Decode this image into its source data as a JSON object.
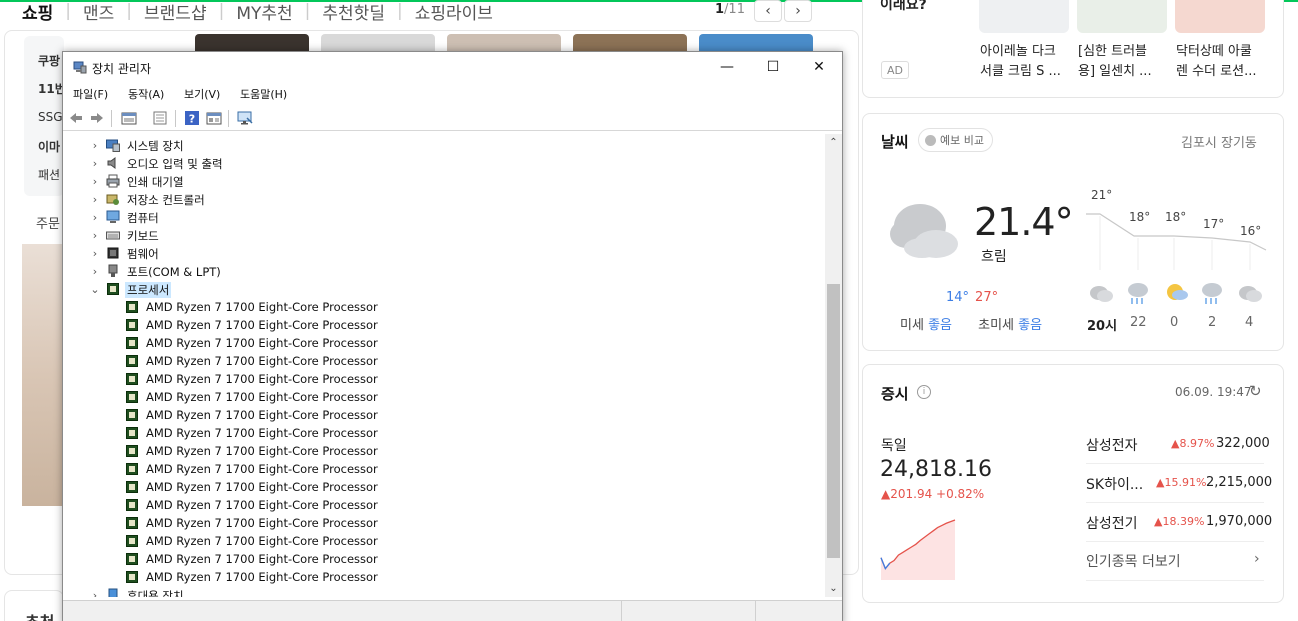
{
  "shopping": {
    "tabs": [
      "쇼핑",
      "맨즈",
      "브랜드샵",
      "MY추천",
      "추천핫딜",
      "쇼핑라이브"
    ],
    "page_current": "1",
    "page_total": "/11",
    "prev_glyph": "‹",
    "next_glyph": "›",
    "left_menu": [
      "쿠팡",
      "11번",
      "SSG",
      "이마",
      "패션"
    ],
    "order_label": "주문",
    "bottom_label": "추천"
  },
  "ad": {
    "title": "이래요?",
    "badge": "AD",
    "items": [
      {
        "line1": "아이레놀 다크",
        "line2": "서클 크림 S ..."
      },
      {
        "line1": "[심한 트러블",
        "line2": "용] 일센치 ..."
      },
      {
        "line1": "닥터상떼 아쿨",
        "line2": "렌 수더 로션..."
      }
    ]
  },
  "weather": {
    "title": "날씨",
    "compare_label": "예보 비교",
    "location": "김포시 장기동",
    "temp": "21.4°",
    "condition": "흐림",
    "low": "14°",
    "high": "27°",
    "dust_label": "미세",
    "dust_value": "좋음",
    "ultra_label": "초미세",
    "ultra_value": "좋음",
    "hourly_temps": [
      "21°",
      "18°",
      "18°",
      "17°",
      "16°"
    ],
    "hourly_hours": [
      "20시",
      "22",
      "0",
      "2",
      "4"
    ],
    "hourly_icons": [
      "cloudy-icon",
      "rain-icon",
      "moon-icon",
      "rain-icon",
      "cloudy-icon"
    ]
  },
  "stocks": {
    "title": "증시",
    "info_glyph": "i",
    "time": "06.09. 19:47",
    "refresh_glyph": "↻",
    "index_name": "독일",
    "index_value": "24,818.16",
    "index_change": "▲201.94 +0.82%",
    "chart_data": {
      "type": "line",
      "values": [
        0.3,
        0.1,
        0.2,
        0.25,
        0.35,
        0.4,
        0.45,
        0.5,
        0.55,
        0.62,
        0.68,
        0.74,
        0.8,
        0.86,
        0.9,
        0.94,
        0.97,
        1.0
      ],
      "colors": {
        "line": "#e5534b",
        "fill": "#fde3e3",
        "dip": "#3c7ee5"
      }
    },
    "items": [
      {
        "name": "삼성전자",
        "pct": "▲8.97%",
        "price": "322,000"
      },
      {
        "name": "SK하이...",
        "pct": "▲15.91%",
        "price": "2,215,000"
      },
      {
        "name": "삼성전기",
        "pct": "▲18.39%",
        "price": "1,970,000"
      }
    ],
    "more_label": "인기종목 더보기",
    "more_arrow": "›"
  },
  "device_manager": {
    "title": "장치 관리자",
    "controls": {
      "minimize": "—",
      "maximize": "☐",
      "close": "✕"
    },
    "menu": [
      "파일(F)",
      "동작(A)",
      "보기(V)",
      "도움말(H)"
    ],
    "toolbar_icons": [
      "back-icon",
      "forward-icon",
      "properties-icon",
      "update-icon",
      "help-icon",
      "view-icon",
      "monitor-icon"
    ],
    "categories": [
      {
        "label": "시스템 장치",
        "expanded": false,
        "icon": "system-devices-icon"
      },
      {
        "label": "오디오 입력 및 출력",
        "expanded": false,
        "icon": "audio-icon"
      },
      {
        "label": "인쇄 대기열",
        "expanded": false,
        "icon": "printer-icon"
      },
      {
        "label": "저장소 컨트롤러",
        "expanded": false,
        "icon": "storage-icon"
      },
      {
        "label": "컴퓨터",
        "expanded": false,
        "icon": "computer-icon"
      },
      {
        "label": "키보드",
        "expanded": false,
        "icon": "keyboard-icon"
      },
      {
        "label": "펌웨어",
        "expanded": false,
        "icon": "firmware-icon"
      },
      {
        "label": "포트(COM & LPT)",
        "expanded": false,
        "icon": "port-icon"
      },
      {
        "label": "프로세서",
        "expanded": true,
        "icon": "processor-icon"
      }
    ],
    "processors": [
      "AMD Ryzen 7 1700 Eight-Core Processor",
      "AMD Ryzen 7 1700 Eight-Core Processor",
      "AMD Ryzen 7 1700 Eight-Core Processor",
      "AMD Ryzen 7 1700 Eight-Core Processor",
      "AMD Ryzen 7 1700 Eight-Core Processor",
      "AMD Ryzen 7 1700 Eight-Core Processor",
      "AMD Ryzen 7 1700 Eight-Core Processor",
      "AMD Ryzen 7 1700 Eight-Core Processor",
      "AMD Ryzen 7 1700 Eight-Core Processor",
      "AMD Ryzen 7 1700 Eight-Core Processor",
      "AMD Ryzen 7 1700 Eight-Core Processor",
      "AMD Ryzen 7 1700 Eight-Core Processor",
      "AMD Ryzen 7 1700 Eight-Core Processor",
      "AMD Ryzen 7 1700 Eight-Core Processor",
      "AMD Ryzen 7 1700 Eight-Core Processor",
      "AMD Ryzen 7 1700 Eight-Core Processor"
    ],
    "after_processors": {
      "label": "휴대용 장치",
      "icon": "portable-device-icon"
    },
    "expand_glyph": "›",
    "collapse_glyph": "⌄",
    "scroll_up": "⌃",
    "scroll_down": "⌄"
  }
}
